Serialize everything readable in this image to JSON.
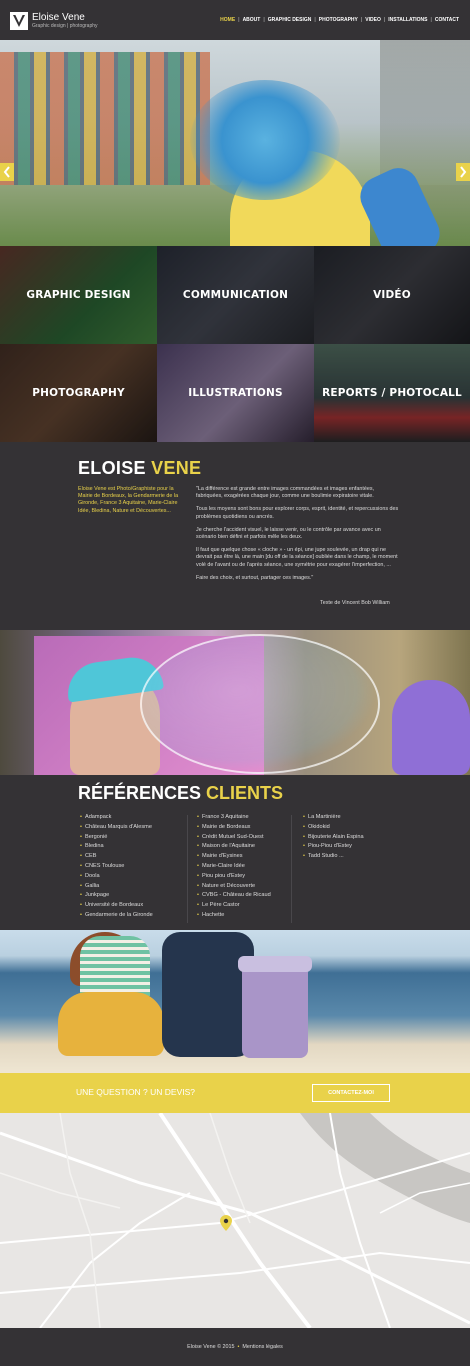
{
  "header": {
    "logo_name": "Eloise Vene",
    "logo_tagline": "Graphic design | photography",
    "nav": [
      {
        "label": "HOME",
        "active": true
      },
      {
        "label": "ABOUT",
        "active": false
      },
      {
        "label": "GRAPHIC DESIGN",
        "active": false
      },
      {
        "label": "PHOTOGRAPHY",
        "active": false
      },
      {
        "label": "VIDEO",
        "active": false
      },
      {
        "label": "INSTALLATIONS",
        "active": false
      },
      {
        "label": "CONTACT",
        "active": false
      }
    ]
  },
  "hero": {
    "prev_icon": "chevron-left-icon",
    "next_icon": "chevron-right-icon"
  },
  "categories": [
    {
      "label": "GRAPHIC DESIGN"
    },
    {
      "label": "COMMUNICATION"
    },
    {
      "label": "VIDÉO"
    },
    {
      "label": "PHOTOGRAPHY"
    },
    {
      "label": "ILLUSTRATIONS"
    },
    {
      "label": "REPORTS / PHOTOCALL"
    }
  ],
  "about": {
    "title_part1": "ELOISE",
    "title_part2": "VENE",
    "intro": "Eloise Vene est Photo/Graphiste pour la Mairie de Bordeaux, la Gendarmerie de la Gironde, France 3 Aquitaine, Marie-Claire Idée, Bledina, Nature et Découvertes...",
    "quote_paragraphs": [
      "\"La différence est grande entre images commandées et images enfantées, fabriquées, exagérées chaque jour, comme une boulimie expiratoire vitale.",
      "Tous les moyens sont bons pour explorer corps, esprit, identité, et repercussions des problèmes quotidiens ou ancrés.",
      "Je cherche l'accident visuel, le laisse venir, ou le contrôle par avance avec un scénario bien défini et parfois mêle les deux.",
      "Il faut que quelque chose « cloche » - un épi, une jupe soulevée, un drap qui ne devrait pas être là, une main [du off de la séance] oubliée dans le champ, le moment volé de l'avant ou de l'après séance, une symétrie pour exagérer l'imperfection, ...",
      "Faire des choix, et surtout, partager ces images.\""
    ],
    "credit": "Texte de Vincent Bob William"
  },
  "references": {
    "title_part1": "RÉFÉRENCES",
    "title_part2": "CLIENTS",
    "col1": [
      "Adampack",
      "Château Marquis d'Alesme",
      "Bergonié",
      "Bledina",
      "CEB",
      "CNES Toulouse",
      "Doola",
      "Gallia",
      "Junkpage",
      "Université de Bordeaux",
      "Gendarmerie de la Gironde"
    ],
    "col2": [
      "France 3 Aquitaine",
      "Mairie de Bordeaux",
      "Crédit Mutuel Sud-Ouest",
      "Maison de l'Aquitaine",
      "Mairie d'Eysines",
      "Marie-Claire Idée",
      "Piou piou d'Estey",
      "Nature et Découverte",
      "CVBG - Château de Ricaud",
      "Le Père Castor",
      "Hachette"
    ],
    "col3": [
      "La Martinière",
      "Okidokid",
      "Bijouterie Alain Espina",
      "Piou-Piou d'Estey",
      "Tadd Studio ..."
    ]
  },
  "cta": {
    "text": "UNE QUESTION ? UN DEVIS?",
    "button": "CONTACTEZ-MOI"
  },
  "map": {
    "marker_icon": "map-pin-icon"
  },
  "footer": {
    "copyright": "Eloise Vene © 2015",
    "legal": "Mentions légales"
  },
  "colors": {
    "accent": "#e9d24a",
    "background": "#343235"
  }
}
